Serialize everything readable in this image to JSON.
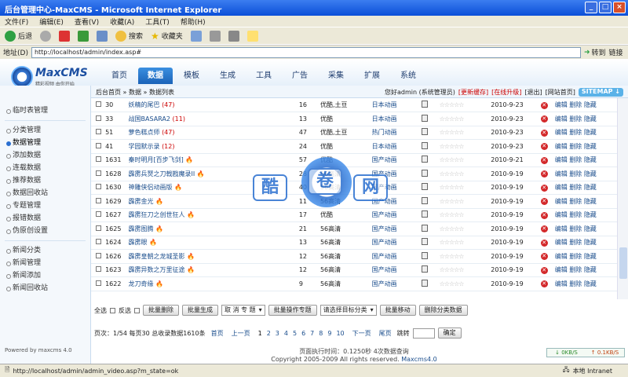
{
  "window": {
    "title": "后台管理中心-MaxCMS - Microsoft Internet Explorer",
    "controls": [
      "_",
      "□",
      "×"
    ]
  },
  "menu": [
    "文件(F)",
    "编辑(E)",
    "查看(V)",
    "收藏(A)",
    "工具(T)",
    "帮助(H)"
  ],
  "toolbar": {
    "back": "后退",
    "search": "搜索",
    "favorites": "收藏夹"
  },
  "address": {
    "label": "地址(D)",
    "url": "http://localhost/admin/index.asp#",
    "go": "转到",
    "links": "链接"
  },
  "logo": {
    "name": "MaxCMS",
    "slogan": "精彩视频 由你开始"
  },
  "nav": [
    "首页",
    "数据",
    "模板",
    "生成",
    "工具",
    "广告",
    "采集",
    "扩展",
    "系统"
  ],
  "breadcrumb": "后台首页 » 数据 » 数据列表",
  "user": {
    "greeting": "您好admin (系统管理员)",
    "update_cache": "[更新缓存]",
    "online_upgrade": "[在线升级]",
    "logout": "[退出]",
    "site_home": "[网站首页]",
    "sitemap": "SITEMAP ↓"
  },
  "sidebar": {
    "group1": [
      "临时表管理"
    ],
    "group2": [
      "分类管理",
      "数据管理",
      "添加数据",
      "连载数据",
      "推荐数据",
      "数据回收站",
      "专题管理",
      "报错数据",
      "伪原创设置"
    ],
    "group3": [
      "新闻分类",
      "新闻管理",
      "新闻添加",
      "新闻回收站"
    ],
    "active": "数据管理",
    "powered": "Powered by maxcms 4.0"
  },
  "rows": [
    {
      "id": "30",
      "title": "妖精的尾巴",
      "hot": "(47)",
      "fire": "",
      "num": "16",
      "tag": "优酷,土豆",
      "cat": "日本动画",
      "date": "2010-9-23"
    },
    {
      "id": "33",
      "title": "战国BASARA2",
      "hot": "(11)",
      "fire": "",
      "num": "13",
      "tag": "优酷",
      "cat": "日本动画",
      "date": "2010-9-23"
    },
    {
      "id": "51",
      "title": "萝色糕点师",
      "hot": "(47)",
      "fire": "",
      "num": "47",
      "tag": "优酷,土豆",
      "cat": "热门动画",
      "date": "2010-9-23"
    },
    {
      "id": "41",
      "title": "学园默示录",
      "hot": "(12)",
      "fire": "",
      "num": "24",
      "tag": "优酷",
      "cat": "日本动画",
      "date": "2010-9-23"
    },
    {
      "id": "1631",
      "title": "秦时明月[百步飞剑]",
      "hot": "",
      "fire": "🔥",
      "num": "57",
      "tag": "优酷",
      "cat": "国产动画",
      "date": "2010-9-21"
    },
    {
      "id": "1628",
      "title": "霹雳兵燹之刀戟戡魔录II",
      "hot": "",
      "fire": "🔥",
      "num": "28",
      "tag": "56高清",
      "cat": "国产动画",
      "date": "2010-9-19"
    },
    {
      "id": "1630",
      "title": "神雕侠侣动画版",
      "hot": "",
      "fire": "🔥",
      "num": "40",
      "tag": "56高清",
      "cat": "国产动画",
      "date": "2010-9-19"
    },
    {
      "id": "1629",
      "title": "霹雳金光",
      "hot": "",
      "fire": "🔥",
      "num": "11",
      "tag": "56高清",
      "cat": "国产动画",
      "date": "2010-9-19"
    },
    {
      "id": "1627",
      "title": "霹雳狂刀之创世狂人",
      "hot": "",
      "fire": "🔥",
      "num": "17",
      "tag": "优酷",
      "cat": "国产动画",
      "date": "2010-9-19"
    },
    {
      "id": "1625",
      "title": "霹雳图腾",
      "hot": "",
      "fire": "🔥",
      "num": "21",
      "tag": "56高清",
      "cat": "国产动画",
      "date": "2010-9-19"
    },
    {
      "id": "1624",
      "title": "霹雳眼",
      "hot": "",
      "fire": "🔥",
      "num": "13",
      "tag": "56高清",
      "cat": "国产动画",
      "date": "2010-9-19"
    },
    {
      "id": "1626",
      "title": "霹雳皇朝之龙城圣影",
      "hot": "",
      "fire": "🔥",
      "num": "12",
      "tag": "56高清",
      "cat": "国产动画",
      "date": "2010-9-19"
    },
    {
      "id": "1623",
      "title": "霹雳异数之万里征途",
      "hot": "",
      "fire": "🔥",
      "num": "12",
      "tag": "56高清",
      "cat": "国产动画",
      "date": "2010-9-19"
    },
    {
      "id": "1622",
      "title": "龙刀奇缘",
      "hot": "",
      "fire": "🔥",
      "num": "9",
      "tag": "56高清",
      "cat": "国产动画",
      "date": "2010-9-19"
    }
  ],
  "row_actions": [
    "编辑",
    "删除",
    "隐藏"
  ],
  "stars": "☆☆☆☆☆",
  "actions": {
    "select_all": "全选",
    "invert": "反选",
    "batch_delete": "批量删除",
    "batch_generate": "批量生成",
    "topic_select": "取 消 专 题",
    "batch_topic": "批量操作专题",
    "target_select": "请选择目标分类",
    "batch_move": "批量移动",
    "delete_category": "删除分类数据"
  },
  "pagination": {
    "info": "页次：1/54 每页30 总收录数据1610条",
    "first": "首页",
    "prev": "上一页",
    "pages": [
      "1",
      "2",
      "3",
      "4",
      "5",
      "6",
      "7",
      "8",
      "9",
      "10"
    ],
    "next": "下一页",
    "last": "尾页",
    "jump": "跳转",
    "confirm": "确定"
  },
  "footer": {
    "exec": "页面执行时间：0.1250秒 4次数据查询",
    "copyright": "Copyright 2005-2009 All rights reserved.",
    "brand": "Maxcms4.0"
  },
  "net": {
    "down": "0KB/S",
    "up": "0.1KB/S"
  },
  "status": {
    "url": "http://localhost/admin/admin_video.asp?m_state=ok",
    "zone": "本地 Intranet"
  },
  "watermark": [
    "酷",
    "卷",
    "网"
  ]
}
